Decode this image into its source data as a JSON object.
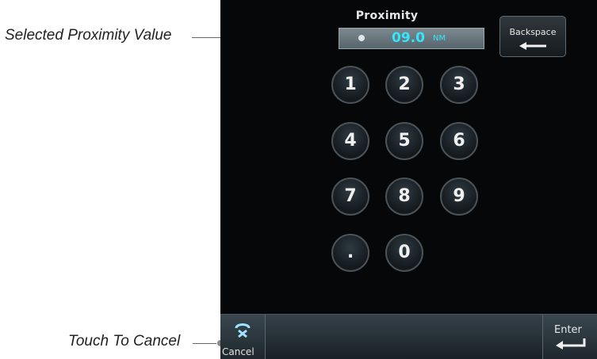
{
  "callouts": {
    "selected_value": "Selected Proximity Value",
    "cancel": "Touch To Cancel"
  },
  "screen": {
    "title": "Proximity",
    "value": "09.0",
    "unit": "NM",
    "backspace_label": "Backspace",
    "keys": [
      "1",
      "2",
      "3",
      "4",
      "5",
      "6",
      "7",
      "8",
      "9",
      ".",
      "0"
    ],
    "cancel_label": "Cancel",
    "enter_label": "Enter"
  },
  "colors": {
    "screen_bg": "#050708",
    "value_text": "#33e6ff",
    "field_bg": "#6b787e"
  },
  "icons": {
    "backspace": "left-arrow-icon",
    "cancel": "cancel-icon",
    "enter": "enter-arrow-icon"
  }
}
